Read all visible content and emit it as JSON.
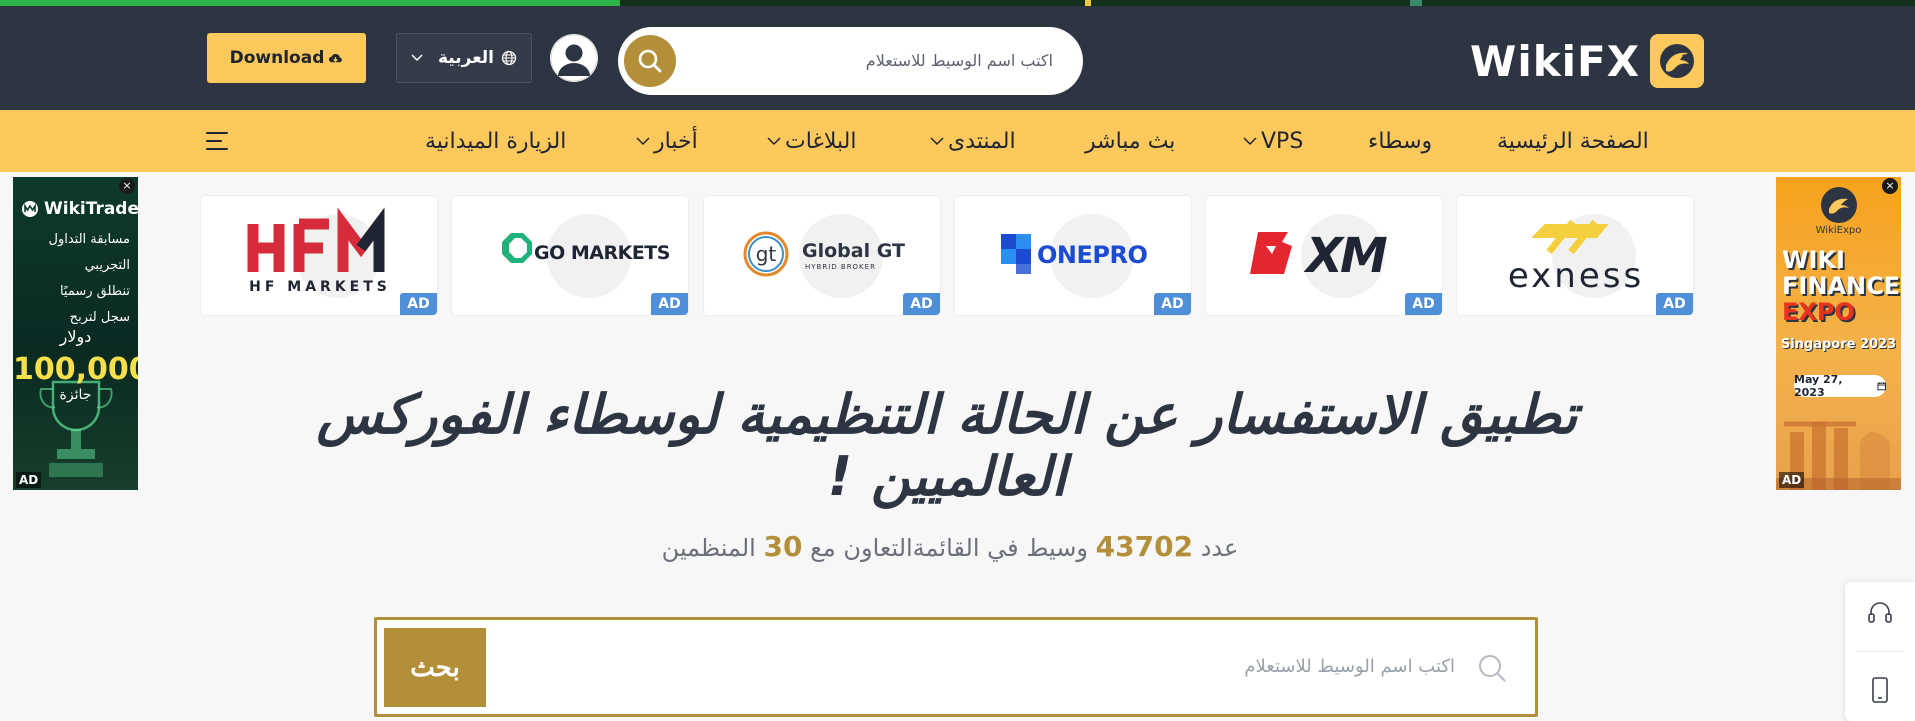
{
  "header": {
    "download_label": "Download",
    "language_label": "العربية",
    "search_placeholder": "اكتب اسم الوسيط للاستعلام",
    "logo_text": "WikiFX"
  },
  "nav": {
    "items": [
      {
        "label": "الصفحة الرئيسية"
      },
      {
        "label": "وسطاء"
      },
      {
        "label": "VPS"
      },
      {
        "label": "بث مباشر"
      },
      {
        "label": "المنتدى"
      },
      {
        "label": "البلاغات"
      },
      {
        "label": "أخبار"
      },
      {
        "label": "الزيارة الميدانية"
      }
    ]
  },
  "left_ad": {
    "brand": "WikiTrade",
    "lines": [
      "مسابقة التداول",
      "التجريبي",
      "تنطلق رسميًا",
      "سجل لتربح"
    ],
    "currency": "دولار",
    "amount": "100,000",
    "prize": "جائزة",
    "tag": "AD",
    "close": "×"
  },
  "right_ad": {
    "brand": "WikiExpo",
    "title_line1": "WIKI",
    "title_line2": "FINANCE",
    "title_line3": "EXPO",
    "location": "Singapore 2023",
    "date": "May 27, 2023",
    "tag": "AD",
    "close": "×"
  },
  "brokers": [
    {
      "name": "HF MARKETS",
      "ad": "AD"
    },
    {
      "name": "GO MARKETS",
      "ad": "AD"
    },
    {
      "name": "Global GT",
      "ad": "AD"
    },
    {
      "name": "ONEPRO",
      "ad": "AD"
    },
    {
      "name": "XM",
      "ad": "AD"
    },
    {
      "name": "exness",
      "ad": "AD"
    }
  ],
  "hero": {
    "title_line1": "تطبيق الاستفسار عن الحالة التنظيمية لوسطاء الفوركس",
    "title_line2": "العالميين !"
  },
  "stats": {
    "prefix": "عدد",
    "broker_count": "43702",
    "middle": "وسيط في القائمةالتعاون مع",
    "regulator_count": "30",
    "suffix": "المنظمين"
  },
  "main_search": {
    "placeholder": "اكتب اسم الوسيط للاستعلام",
    "button_label": "بحث"
  },
  "colors": {
    "header_bg": "#2e3542",
    "nav_bg": "#fdc85c",
    "accent_gold": "#b38f3a",
    "ad_badge": "#4f8fd8"
  }
}
